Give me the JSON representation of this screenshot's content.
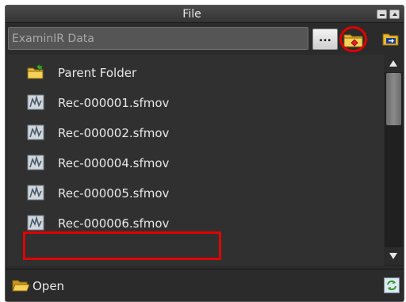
{
  "window": {
    "title": "File"
  },
  "path": {
    "value": "ExaminIR Data",
    "browse_label": "..."
  },
  "toolbar": {
    "new_folder_icon": "new-folder-icon",
    "export_icon": "export-icon"
  },
  "list": {
    "items": [
      {
        "label": "Parent Folder",
        "icon": "parent-folder-icon"
      },
      {
        "label": "Rec-000001.sfmov",
        "icon": "movie-file-icon"
      },
      {
        "label": "Rec-000002.sfmov",
        "icon": "movie-file-icon"
      },
      {
        "label": "Rec-000004.sfmov",
        "icon": "movie-file-icon"
      },
      {
        "label": "Rec-000005.sfmov",
        "icon": "movie-file-icon"
      },
      {
        "label": "Rec-000006.sfmov",
        "icon": "movie-file-icon"
      }
    ],
    "highlighted": "Rec-000006.sfmov"
  },
  "footer": {
    "open_label": "Open",
    "refresh_icon": "refresh-icon"
  },
  "colors": {
    "panel_bg": "#2b2b2b",
    "list_bg": "#303030",
    "text": "#e8e8e8",
    "annotation_red": "#e00000"
  }
}
